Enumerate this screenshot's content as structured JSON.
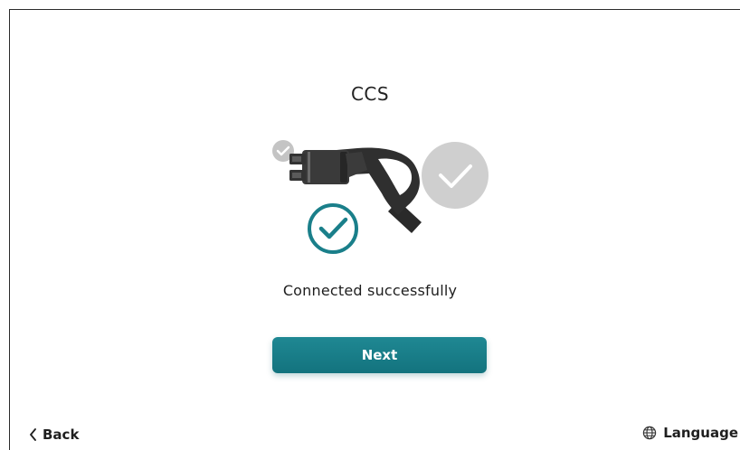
{
  "header": {
    "title": "CCS"
  },
  "main": {
    "status_text": "Connected successfully",
    "illustration_icons": [
      "small-check-icon",
      "ccs-plug-icon",
      "success-check-icon",
      "gray-check-icon"
    ]
  },
  "actions": {
    "next_label": "Next"
  },
  "footer": {
    "back_label": "Back",
    "back_icon": "chevron-left-icon",
    "language_label": "Language",
    "language_icon": "globe-icon"
  },
  "colors": {
    "accent": "#1a7f8a",
    "check_gray": "#c9c9c9",
    "plug_dark": "#2c2c2c"
  }
}
